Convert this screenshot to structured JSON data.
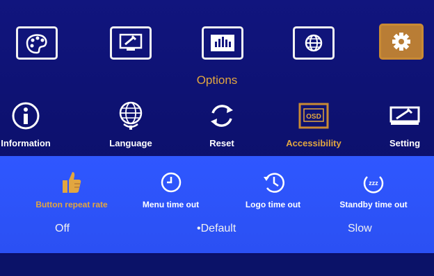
{
  "colors": {
    "background": "#0d1170",
    "panel": "#2f57ff",
    "accent": "#e2a640",
    "text": "#ffffff"
  },
  "top_menu": [
    {
      "name": "picture-icon",
      "active": false
    },
    {
      "name": "monitor-settings-icon",
      "active": false
    },
    {
      "name": "equalizer-icon",
      "active": false
    },
    {
      "name": "globe-icon",
      "active": false
    },
    {
      "name": "gear-icon",
      "active": true
    }
  ],
  "options_title": "Options",
  "sub_menu": [
    {
      "label": "Information",
      "icon": "info-icon"
    },
    {
      "label": "Language",
      "icon": "globe-icon"
    },
    {
      "label": "Reset",
      "icon": "reset-icon"
    },
    {
      "label": "Accessibility",
      "icon": "osd-icon",
      "active": true,
      "icon_text": "OSD"
    },
    {
      "label": "Setting",
      "icon": "setting-icon"
    }
  ],
  "params": [
    {
      "label": "Button repeat rate",
      "icon": "thumbs-up-icon",
      "active": true
    },
    {
      "label": "Menu time out",
      "icon": "clock-icon"
    },
    {
      "label": "Logo time out",
      "icon": "history-clock-icon"
    },
    {
      "label": "Standby time out",
      "icon": "sleep-icon",
      "icon_text": "zzz"
    }
  ],
  "values": [
    {
      "label": "Off",
      "selected": false
    },
    {
      "label": "Default",
      "selected": true,
      "marker": "•"
    },
    {
      "label": "Slow",
      "selected": false
    }
  ]
}
